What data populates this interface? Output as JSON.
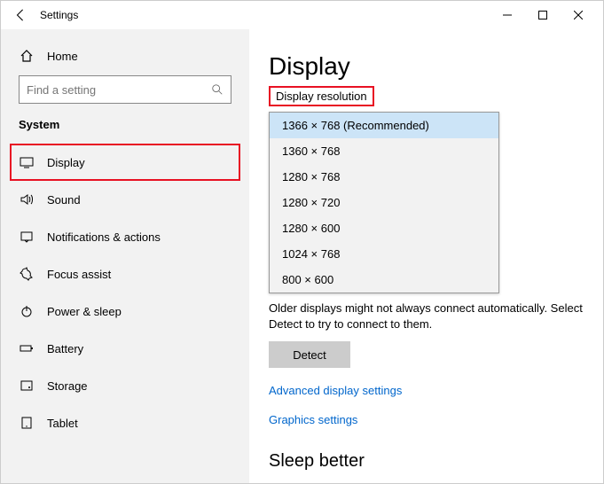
{
  "window": {
    "title": "Settings"
  },
  "sidebar": {
    "home": "Home",
    "search_placeholder": "Find a setting",
    "section": "System",
    "items": [
      {
        "label": "Display",
        "icon": "display",
        "selected": true
      },
      {
        "label": "Sound",
        "icon": "sound"
      },
      {
        "label": "Notifications & actions",
        "icon": "notifications"
      },
      {
        "label": "Focus assist",
        "icon": "focus"
      },
      {
        "label": "Power & sleep",
        "icon": "power"
      },
      {
        "label": "Battery",
        "icon": "battery"
      },
      {
        "label": "Storage",
        "icon": "storage"
      },
      {
        "label": "Tablet",
        "icon": "tablet"
      }
    ]
  },
  "content": {
    "heading": "Display",
    "resolution_label": "Display resolution",
    "options": [
      "1366 × 768 (Recommended)",
      "1360 × 768",
      "1280 × 768",
      "1280 × 720",
      "1280 × 600",
      "1024 × 768",
      "800 × 600"
    ],
    "selected_option": 0,
    "detect_text": "Older displays might not always connect automatically. Select Detect to try to connect to them.",
    "detect_button": "Detect",
    "link_advanced": "Advanced display settings",
    "link_graphics": "Graphics settings",
    "sleep_heading": "Sleep better"
  }
}
